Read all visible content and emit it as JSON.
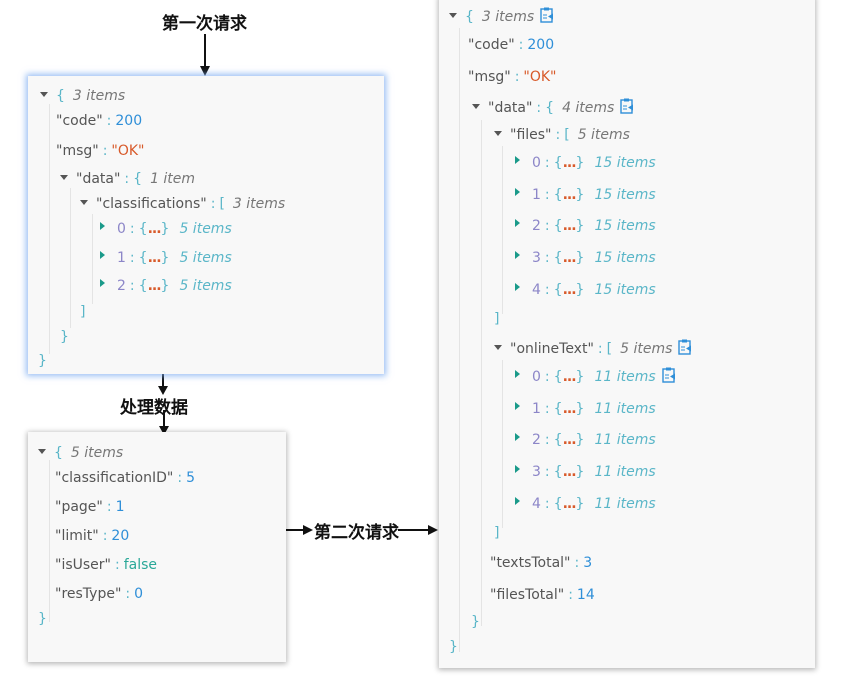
{
  "labels": {
    "first_request": "第一次请求",
    "process_data": "处理数据",
    "second_request": "第二次请求"
  },
  "colors": {
    "key": "#555555",
    "number": "#2f8fd8",
    "string": "#d85a2a",
    "boolean": "#2aa898",
    "brace": "#5ab6c8",
    "index": "#8c86c8",
    "highlight_border": "#78aaf0"
  },
  "panel1": {
    "root": {
      "brace": "{",
      "count": "3 items"
    },
    "code": {
      "key": "\"code\"",
      "value": "200"
    },
    "msg": {
      "key": "\"msg\"",
      "value": "\"OK\""
    },
    "data": {
      "key": "\"data\"",
      "brace": "{",
      "count": "1 item"
    },
    "classifications": {
      "key": "\"classifications\"",
      "brace": "[",
      "count": "3 items"
    },
    "items": [
      {
        "index": "0",
        "collapsed": "{...}",
        "count": "5 items"
      },
      {
        "index": "1",
        "collapsed": "{...}",
        "count": "5 items"
      },
      {
        "index": "2",
        "collapsed": "{...}",
        "count": "5 items"
      }
    ],
    "close_array": "]",
    "close_data": "}",
    "close_root": "}"
  },
  "panel2": {
    "root": {
      "brace": "{",
      "count": "5 items"
    },
    "fields": [
      {
        "key": "\"classificationID\"",
        "value": "5",
        "type": "number"
      },
      {
        "key": "\"page\"",
        "value": "1",
        "type": "number"
      },
      {
        "key": "\"limit\"",
        "value": "20",
        "type": "number"
      },
      {
        "key": "\"isUser\"",
        "value": "false",
        "type": "boolean"
      },
      {
        "key": "\"resType\"",
        "value": "0",
        "type": "number"
      }
    ],
    "close_root": "}"
  },
  "panel3": {
    "root": {
      "brace": "{",
      "count": "3 items"
    },
    "code": {
      "key": "\"code\"",
      "value": "200"
    },
    "msg": {
      "key": "\"msg\"",
      "value": "\"OK\""
    },
    "data": {
      "key": "\"data\"",
      "brace": "{",
      "count": "4 items"
    },
    "files": {
      "key": "\"files\"",
      "brace": "[",
      "count": "5 items"
    },
    "files_items": [
      {
        "index": "0",
        "collapsed": "{...}",
        "count": "15 items"
      },
      {
        "index": "1",
        "collapsed": "{...}",
        "count": "15 items"
      },
      {
        "index": "2",
        "collapsed": "{...}",
        "count": "15 items"
      },
      {
        "index": "3",
        "collapsed": "{...}",
        "count": "15 items"
      },
      {
        "index": "4",
        "collapsed": "{...}",
        "count": "15 items"
      }
    ],
    "online": {
      "key": "\"onlineText\"",
      "brace": "[",
      "count": "5 items"
    },
    "online_items": [
      {
        "index": "0",
        "collapsed": "{...}",
        "count": "11 items"
      },
      {
        "index": "1",
        "collapsed": "{...}",
        "count": "11 items"
      },
      {
        "index": "2",
        "collapsed": "{...}",
        "count": "11 items"
      },
      {
        "index": "3",
        "collapsed": "{...}",
        "count": "11 items"
      },
      {
        "index": "4",
        "collapsed": "{...}",
        "count": "11 items"
      }
    ],
    "textsTotal": {
      "key": "\"textsTotal\"",
      "value": "3"
    },
    "filesTotal": {
      "key": "\"filesTotal\"",
      "value": "14"
    },
    "close_array": "]",
    "close_data": "}",
    "close_root": "}"
  }
}
